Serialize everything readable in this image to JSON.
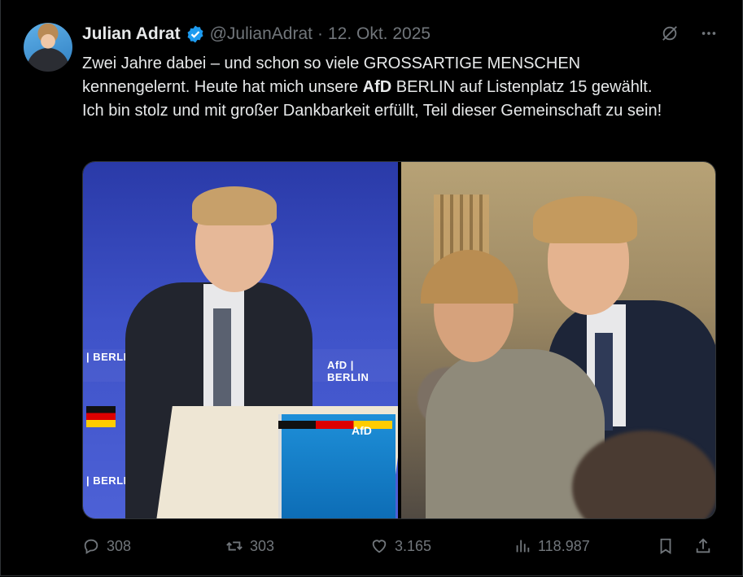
{
  "author": {
    "name": "Julian Adrat",
    "handle": "@JulianAdrat",
    "separator": "·",
    "date": "12. Okt. 2025",
    "verified_color": "#1d9bf0"
  },
  "tweet": {
    "part1": "Zwei Jahre dabei – und schon so viele GROSSARTIGE MENSCHEN kennengelernt. Heute hat mich unsere ",
    "bold": "AfD",
    "part2": " BERLIN auf Listenplatz 15 gewählt. Ich bin stolz und mit großer Dankbarkeit erfüllt, Teil dieser Gemeinschaft zu sein!"
  },
  "media": {
    "left_tags": [
      "| BERLIN",
      "AfD | BERLIN",
      "| BERLIN"
    ],
    "podium_logo": "AfD"
  },
  "actions": {
    "replies": "308",
    "reposts": "303",
    "likes": "3.165",
    "views": "118.987"
  },
  "colors": {
    "background": "#000000",
    "text": "#e7e9ea",
    "muted": "#71767b",
    "accent": "#1d9bf0"
  },
  "icons": [
    "grok-icon",
    "more-icon",
    "reply-icon",
    "repost-icon",
    "like-icon",
    "views-icon",
    "bookmark-icon",
    "share-icon"
  ]
}
